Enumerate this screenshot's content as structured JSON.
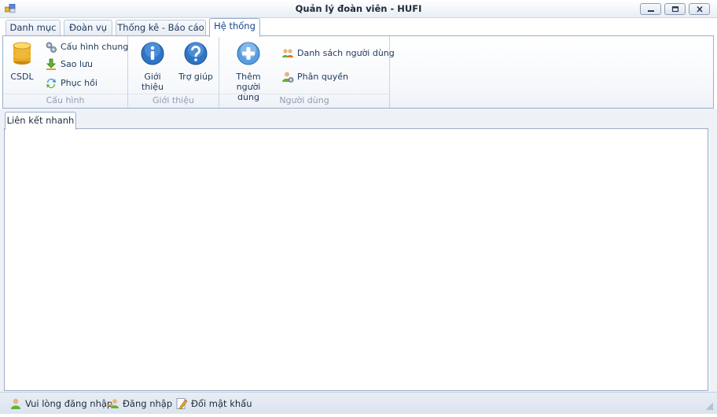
{
  "window": {
    "title": "Quản lý đoàn viên - HUFI",
    "controls": [
      "minimize-icon",
      "maximize-icon",
      "close-icon"
    ]
  },
  "ribbon": {
    "tabs": [
      {
        "label": "Danh mục"
      },
      {
        "label": "Đoàn vụ"
      },
      {
        "label": "Thống kê - Báo cáo"
      },
      {
        "label": "Hệ thống",
        "active": true
      }
    ],
    "groups": {
      "cauhinh": {
        "caption": "Cấu hình",
        "csdl": "CSDL",
        "items": [
          "Cấu hình chung",
          "Sao lưu",
          "Phục hồi"
        ]
      },
      "gioithieu": {
        "caption": "Giới thiệu",
        "about": "Giới thiệu",
        "help": "Trợ giúp"
      },
      "nguoidung": {
        "caption": "Người dùng",
        "add_user_line1": "Thêm người",
        "add_user_line2": "dùng",
        "user_list": "Danh sách người dùng",
        "permissions": "Phân quyền"
      }
    }
  },
  "document": {
    "tab_label": "Liên kết nhanh"
  },
  "statusbar": {
    "login_prompt": "Vui lòng đăng nhập",
    "login": "Đăng nhập",
    "change_password": "Đổi mật khẩu"
  },
  "colors": {
    "accent": "#15428b",
    "border": "#9aaec9",
    "caption": "#8f9db3"
  }
}
